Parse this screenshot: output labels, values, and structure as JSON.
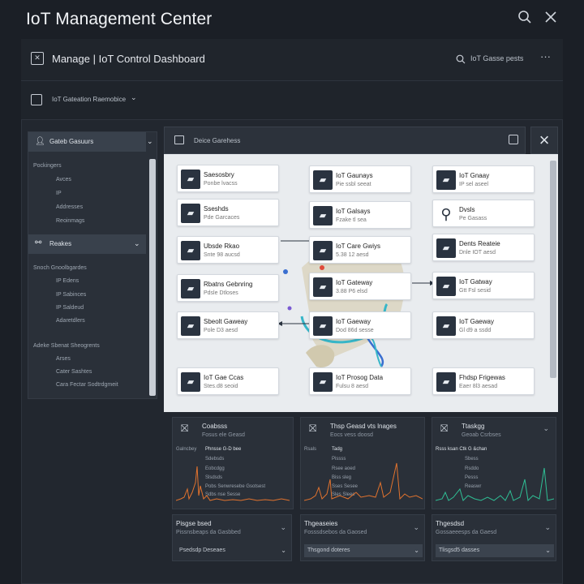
{
  "app": {
    "title": "IoT Management Center"
  },
  "toolbar": {
    "dashboard_title": "Manage | IoT Control Dashboard",
    "search_text": "IoT Gasse pests",
    "more_label": "···"
  },
  "subbar": {
    "label": "IoT Gateation Raemobice"
  },
  "sidebar": {
    "section1": {
      "title": "Gateb Gasuurs",
      "group_label": "Pockingers",
      "items": [
        "Avces",
        "IP",
        "Addresses",
        "Reoinmags"
      ]
    },
    "section2": {
      "title": "Reakes",
      "group_label": "Snoch Gnoolbgardes",
      "items": [
        "IP Edens",
        "IP Sabinces",
        "IP Saldeud",
        "Adaretdlers"
      ]
    },
    "section3": {
      "group_label": "Adeke Sbenat Sheogrents",
      "items": [
        "Arses",
        "Cater Sashtes",
        "Cara Fectar Sodtrdgmeit"
      ]
    }
  },
  "device_panel": {
    "title": "Deice Garehess",
    "close_icon": "×"
  },
  "cards": [
    {
      "title": "Saesosbry",
      "sub": "Ponbe lvacss"
    },
    {
      "title": "IoT Gaunays",
      "sub": "Pie ssbl seeat"
    },
    {
      "title": "IoT Gnaay",
      "sub": "IP sel aseel"
    },
    {
      "title": "Sseshds",
      "sub": "Pde Garcaces"
    },
    {
      "title": "IoT Galsays",
      "sub": "Fzake tl sea"
    },
    {
      "title": "Dvsls",
      "sub": "Pe Gasass"
    },
    {
      "title": "Ubsde Rkao",
      "sub": "Snte 98 aucsd"
    },
    {
      "title": "IoT Care Gwiys",
      "sub": "5.38 12 aesd"
    },
    {
      "title": "Dents Reateie",
      "sub": "Dnle IOT aesd"
    },
    {
      "title": "Rbatns Gebnring",
      "sub": "Pdsle Dtloses"
    },
    {
      "title": "IoT Gateway",
      "sub": "3.88 P6 elsd"
    },
    {
      "title": "IoT Gatway",
      "sub": "Gtt Fsl sesid"
    },
    {
      "title": "Sbeolt Gaweay",
      "sub": "Pole D3 aesd"
    },
    {
      "title": "IoT Gaeway",
      "sub": "Dod 86d sesse"
    },
    {
      "title": "IoT Gaeway",
      "sub": "Gl d9 a ssdd"
    },
    {
      "title": "IoT Gae Ccas",
      "sub": "Stes.d8 seoid"
    },
    {
      "title": "IoT Prosog Data",
      "sub": "Fulsu 8 aesd"
    },
    {
      "title": "Fhdsp Frigewas",
      "sub": "Eaer 8l3 aesad"
    }
  ],
  "widgets": [
    {
      "title": "Coabsss",
      "sub": "Fosus ele Geasd",
      "legend_title": "Phnsse G-D bee",
      "left_label": "Galncbey",
      "lines": [
        "Sdebsds",
        "Eobcdgg",
        "Slsdsds",
        "Pobs Senwresebe Gsotsest",
        "Sdbs nse Sesse"
      ],
      "bar_color": "#e2732e"
    },
    {
      "title": "Thsp Geasd vts lnages",
      "sub": "Eocs vess doosd",
      "legend_title": "Tadg",
      "left_label": "Rsals",
      "lines": [
        "Pissss",
        "Rsee aoed",
        "Biss sleg",
        "Sses Sesee",
        "Sles Sleee"
      ],
      "bar_color": "#e2732e"
    },
    {
      "title": "Ttaskgg",
      "sub": "Geoab Csrbses",
      "legend_title": "Rsss ksan Ctk G &chan",
      "left_label": "",
      "lines": [
        "Sbess",
        "Rsddo",
        "Pesss",
        "Reaswr"
      ],
      "bar_color": "#2fbf95"
    }
  ],
  "bottom_panels": [
    {
      "title": "Pisgse bsed",
      "sub": "Pissnsbeaps da Gasbbed",
      "box": "Psedsdp Deseaes"
    },
    {
      "title": "Thgeaseies",
      "sub": "Fosssdsebos da Gaosed",
      "box": "Thsgond doteres"
    },
    {
      "title": "Thgesdsd",
      "sub": "Gossaeeesps da Gaesd",
      "box": "Tlisgsd5 dasses"
    }
  ]
}
